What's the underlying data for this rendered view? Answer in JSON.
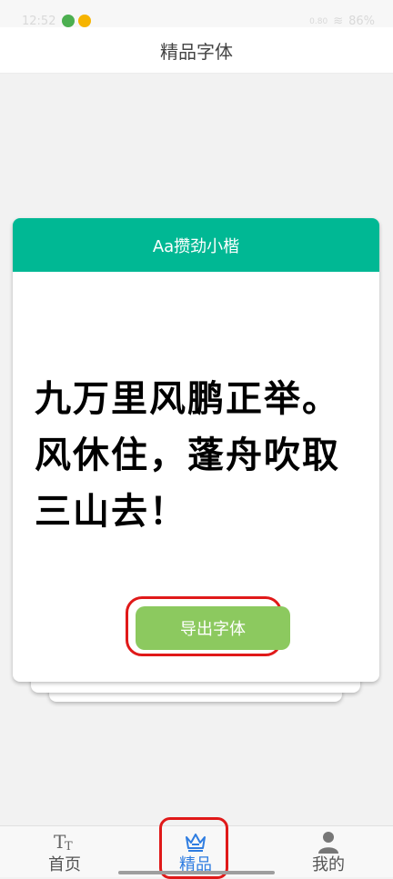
{
  "status_bar": {
    "time": "12:52",
    "speed": "0.80",
    "battery": "86%"
  },
  "header": {
    "title": "精品字体"
  },
  "font_card": {
    "font_name": "Aa攒劲小楷",
    "sample_text": "九万里风鹏正举。风休住，蓬舟吹取三山去！",
    "export_label": "导出字体"
  },
  "nav": {
    "items": [
      {
        "label": "首页",
        "icon": "text-style-icon"
      },
      {
        "label": "精品",
        "icon": "crown-icon",
        "active": true
      },
      {
        "label": "我的",
        "icon": "person-icon"
      }
    ]
  },
  "colors": {
    "card_header": "#00b894",
    "export_button": "#8cc95f",
    "active_nav": "#2f7de1",
    "highlight": "#e01919"
  }
}
